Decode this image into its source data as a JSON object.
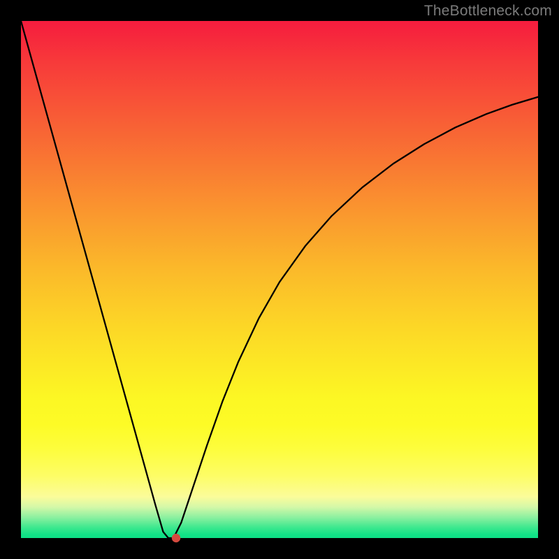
{
  "attribution_text": "TheBottleneck.com",
  "chart_data": {
    "type": "line",
    "title": "",
    "xlabel": "",
    "ylabel": "",
    "xlim": [
      0,
      100
    ],
    "ylim": [
      0,
      100
    ],
    "grid": false,
    "legend": false,
    "x": [
      0,
      2,
      4,
      6,
      8,
      10,
      12,
      14,
      16,
      18,
      20,
      22,
      24,
      26,
      27.5,
      28.5,
      29.5,
      31,
      33,
      36,
      39,
      42,
      46,
      50,
      55,
      60,
      66,
      72,
      78,
      84,
      90,
      95,
      100
    ],
    "y": [
      100,
      92.8,
      85.6,
      78.4,
      71.2,
      64.0,
      56.8,
      49.6,
      42.4,
      35.2,
      28.0,
      20.8,
      13.6,
      6.4,
      1.2,
      0.0,
      0.0,
      3.0,
      9.0,
      18.0,
      26.5,
      34.0,
      42.5,
      49.5,
      56.5,
      62.2,
      67.8,
      72.4,
      76.2,
      79.4,
      82.0,
      83.8,
      85.3
    ],
    "marker": {
      "x": 30.0,
      "y": 0.0
    },
    "background_gradient": {
      "type": "vertical",
      "stops": [
        {
          "pos": 0.0,
          "color": "#f61c3e"
        },
        {
          "pos": 0.18,
          "color": "#f85a36"
        },
        {
          "pos": 0.38,
          "color": "#fa9a2e"
        },
        {
          "pos": 0.6,
          "color": "#fcd926"
        },
        {
          "pos": 0.8,
          "color": "#fdfd3e"
        },
        {
          "pos": 0.96,
          "color": "#8cf0a0"
        },
        {
          "pos": 1.0,
          "color": "#0fe086"
        }
      ]
    }
  }
}
